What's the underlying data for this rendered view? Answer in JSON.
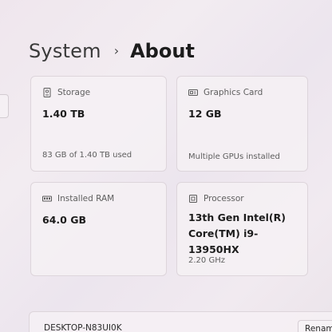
{
  "breadcrumb": {
    "parent": "System",
    "separator": "›",
    "current": "About"
  },
  "cards": {
    "storage": {
      "label": "Storage",
      "value": "1.40 TB",
      "detail": "83 GB of 1.40 TB used",
      "icon": "storage-icon"
    },
    "graphics": {
      "label": "Graphics Card",
      "value": "12 GB",
      "detail": "Multiple GPUs installed",
      "icon": "graphics-card-icon"
    },
    "ram": {
      "label": "Installed RAM",
      "value": "64.0 GB",
      "icon": "ram-icon"
    },
    "processor": {
      "label": "Processor",
      "value": "13th Gen Intel(R) Core(TM) i9-13950HX",
      "detail": "2.20 GHz",
      "icon": "processor-icon"
    }
  },
  "device": {
    "name": "DESKTOP-N83UI0K",
    "rename_label": "Rename"
  }
}
